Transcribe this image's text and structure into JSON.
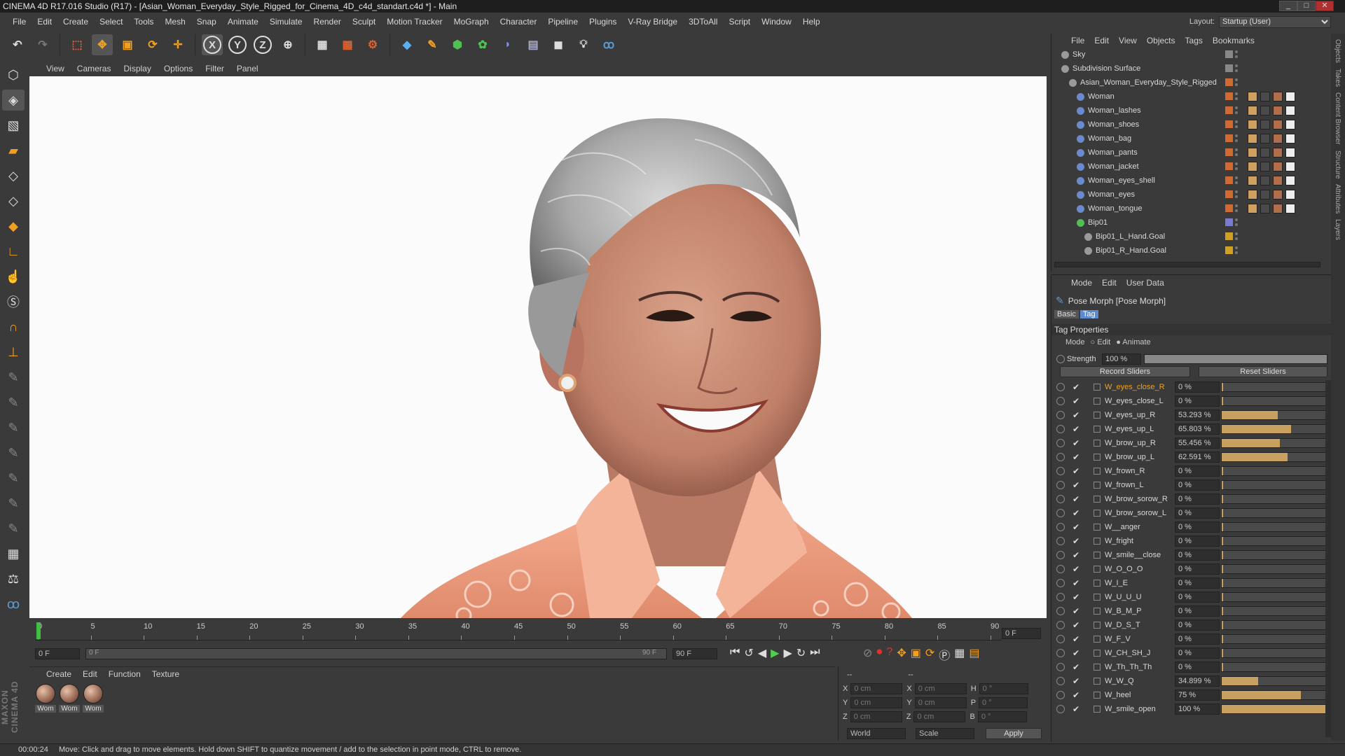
{
  "window": {
    "title": "CINEMA 4D R17.016 Studio (R17) - [Asian_Woman_Everyday_Style_Rigged_for_Cinema_4D_c4d_standart.c4d *] - Main"
  },
  "menu": [
    "File",
    "Edit",
    "Create",
    "Select",
    "Tools",
    "Mesh",
    "Snap",
    "Animate",
    "Simulate",
    "Render",
    "Sculpt",
    "Motion Tracker",
    "MoGraph",
    "Character",
    "Pipeline",
    "Plugins",
    "V-Ray Bridge",
    "3DToAll",
    "Script",
    "Window",
    "Help"
  ],
  "layout": {
    "label": "Layout:",
    "value": "Startup (User)"
  },
  "viewport_menu": [
    "View",
    "Cameras",
    "Display",
    "Options",
    "Filter",
    "Panel"
  ],
  "timeline": {
    "ticks": [
      "0",
      "5",
      "10",
      "15",
      "20",
      "25",
      "30",
      "35",
      "40",
      "45",
      "50",
      "55",
      "60",
      "65",
      "70",
      "75",
      "80",
      "85",
      "90"
    ],
    "end_frame_field": "0 F"
  },
  "transport": {
    "current_frame": "0 F",
    "range_start": "0 F",
    "range_end": "90 F",
    "max_frame": "90 F"
  },
  "material_menu": [
    "Create",
    "Edit",
    "Function",
    "Texture"
  ],
  "materials": [
    "Wom",
    "Wom",
    "Wom"
  ],
  "coords": {
    "header1": "--",
    "header2": "--",
    "rows": [
      {
        "a": "X",
        "av": "0 cm",
        "b": "X",
        "bv": "0 cm",
        "c": "H",
        "cv": "0 °"
      },
      {
        "a": "Y",
        "av": "0 cm",
        "b": "Y",
        "bv": "0 cm",
        "c": "P",
        "cv": "0 °"
      },
      {
        "a": "Z",
        "av": "0 cm",
        "b": "Z",
        "bv": "0 cm",
        "c": "B",
        "cv": "0 °"
      }
    ],
    "world": "World",
    "scale": "Scale",
    "apply": "Apply"
  },
  "status": {
    "time": "00:00:24",
    "message": "Move: Click and drag to move elements. Hold down SHIFT to quantize movement / add to the selection in point mode, CTRL to remove."
  },
  "object_manager": {
    "menu": [
      "File",
      "Edit",
      "View",
      "Objects",
      "Tags",
      "Bookmarks"
    ],
    "objects": [
      {
        "name": "Sky",
        "indent": 0,
        "color": "#888888"
      },
      {
        "name": "Subdivision Surface",
        "indent": 0,
        "color": "#888888"
      },
      {
        "name": "Asian_Woman_Everyday_Style_Rigged",
        "indent": 1,
        "color": "#d06a30"
      },
      {
        "name": "Woman",
        "indent": 2,
        "color": "#d06a30"
      },
      {
        "name": "Woman_lashes",
        "indent": 2,
        "color": "#d06a30"
      },
      {
        "name": "Woman_shoes",
        "indent": 2,
        "color": "#d06a30"
      },
      {
        "name": "Woman_bag",
        "indent": 2,
        "color": "#d06a30"
      },
      {
        "name": "Woman_pants",
        "indent": 2,
        "color": "#d06a30"
      },
      {
        "name": "Woman_jacket",
        "indent": 2,
        "color": "#d06a30"
      },
      {
        "name": "Woman_eyes_shell",
        "indent": 2,
        "color": "#d06a30"
      },
      {
        "name": "Woman_eyes",
        "indent": 2,
        "color": "#d06a30"
      },
      {
        "name": "Woman_tongue",
        "indent": 2,
        "color": "#d06a30"
      },
      {
        "name": "Bip01",
        "indent": 2,
        "color": "#7a7ad0"
      },
      {
        "name": "Bip01_L_Hand.Goal",
        "indent": 3,
        "color": "#d0a020"
      },
      {
        "name": "Bip01_R_Hand.Goal",
        "indent": 3,
        "color": "#d0a020"
      }
    ]
  },
  "attributes": {
    "menu": [
      "Mode",
      "Edit",
      "User Data"
    ],
    "title": "Pose Morph [Pose Morph]",
    "tabs": [
      "Basic",
      "Tag"
    ],
    "section": "Tag Properties",
    "mode_label": "Mode",
    "mode_options": [
      "Edit",
      "Animate"
    ],
    "strength_label": "Strength",
    "strength_value": "100 %",
    "strength_fraction": 1.0,
    "record_sliders": "Record Sliders",
    "reset_sliders": "Reset Sliders",
    "sliders": [
      {
        "name": "W_eyes_close_R",
        "value": "0 %",
        "fraction": 0,
        "highlight": true
      },
      {
        "name": "W_eyes_close_L",
        "value": "0 %",
        "fraction": 0
      },
      {
        "name": "W_eyes_up_R",
        "value": "53.293 %",
        "fraction": 0.53293
      },
      {
        "name": "W_eyes_up_L",
        "value": "65.803 %",
        "fraction": 0.65803
      },
      {
        "name": "W_brow_up_R",
        "value": "55.456 %",
        "fraction": 0.55456
      },
      {
        "name": "W_brow_up_L",
        "value": "62.591 %",
        "fraction": 0.62591
      },
      {
        "name": "W_frown_R",
        "value": "0 %",
        "fraction": 0
      },
      {
        "name": "W_frown_L",
        "value": "0 %",
        "fraction": 0
      },
      {
        "name": "W_brow_sorow_R",
        "value": "0 %",
        "fraction": 0
      },
      {
        "name": "W_brow_sorow_L",
        "value": "0 %",
        "fraction": 0
      },
      {
        "name": "W__anger",
        "value": "0 %",
        "fraction": 0
      },
      {
        "name": "W_fright",
        "value": "0 %",
        "fraction": 0
      },
      {
        "name": "W_smile__close",
        "value": "0 %",
        "fraction": 0
      },
      {
        "name": "W_O_O_O",
        "value": "0 %",
        "fraction": 0
      },
      {
        "name": "W_I_E",
        "value": "0 %",
        "fraction": 0
      },
      {
        "name": "W_U_U_U",
        "value": "0 %",
        "fraction": 0
      },
      {
        "name": "W_B_M_P",
        "value": "0 %",
        "fraction": 0
      },
      {
        "name": "W_D_S_T",
        "value": "0 %",
        "fraction": 0
      },
      {
        "name": "W_F_V",
        "value": "0 %",
        "fraction": 0
      },
      {
        "name": "W_CH_SH_J",
        "value": "0 %",
        "fraction": 0
      },
      {
        "name": "W_Th_Th_Th",
        "value": "0 %",
        "fraction": 0
      },
      {
        "name": "W_W_Q",
        "value": "34.899 %",
        "fraction": 0.34899
      },
      {
        "name": "W_heel",
        "value": "75 %",
        "fraction": 0.75
      },
      {
        "name": "W_smile_open",
        "value": "100 %",
        "fraction": 1.0
      }
    ]
  },
  "side_tabs": [
    "Objects",
    "Takes",
    "Content Browser",
    "Structure",
    "Attributes",
    "Layers"
  ]
}
